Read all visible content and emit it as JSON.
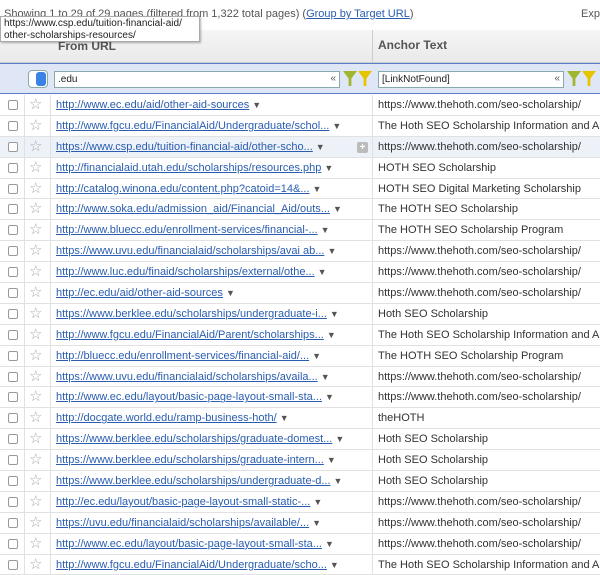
{
  "summary": {
    "text": "Showing 1 to 29 of 29 pages (filtered from 1,322 total pages) (",
    "group_link": "Group by Target URL",
    "close": ")"
  },
  "export_label": "Exp",
  "tooltip": "https://www.csp.edu/tuition-financial-aid/ other-scholarships-resources/",
  "columns": {
    "from_url": "From URL",
    "anchor_text": "Anchor Text"
  },
  "filters": {
    "from_url": ".edu",
    "anchor_text": "[LinkNotFound]",
    "clear": "«"
  },
  "icons": {
    "star": "star-icon",
    "funnel": "filter-funnel-icon",
    "expand": "expand-plus-icon"
  },
  "rows": [
    {
      "url": "http://www.ec.edu/aid/other-aid-sources",
      "anchor": "https://www.thehoth.com/seo-scholarship/"
    },
    {
      "url": "http://www.fgcu.edu/FinancialAid/Undergraduate/schol...",
      "anchor": "The Hoth SEO Scholarship Information and Ap"
    },
    {
      "url": "https://www.csp.edu/tuition-financial-aid/other-scho...",
      "anchor": "https://www.thehoth.com/seo-scholarship/",
      "highlight": true
    },
    {
      "url": "http://financialaid.utah.edu/scholarships/resources.php",
      "anchor": "HOTH SEO Scholarship"
    },
    {
      "url": "http://catalog.winona.edu/content.php?catoid=14&...",
      "anchor": "HOTH SEO Digital Marketing Scholarship"
    },
    {
      "url": "http://www.soka.edu/admission_aid/Financial_Aid/outs...",
      "anchor": "The HOTH SEO Scholarship"
    },
    {
      "url": "http://www.bluecc.edu/enrollment-services/financial-...",
      "anchor": "The HOTH SEO Scholarship Program"
    },
    {
      "url": "https://www.uvu.edu/financialaid/scholarships/avai ab...",
      "anchor": "https://www.thehoth.com/seo-scholarship/"
    },
    {
      "url": "http://www.luc.edu/finaid/scholarships/external/othe...",
      "anchor": "https://www.thehoth.com/seo-scholarship/"
    },
    {
      "url": "http://ec.edu/aid/other-aid-sources",
      "anchor": "https://www.thehoth.com/seo-scholarship/"
    },
    {
      "url": "https://www.berklee.edu/scholarships/undergraduate-i...",
      "anchor": "Hoth SEO Scholarship"
    },
    {
      "url": "http://www.fgcu.edu/FinancialAid/Parent/scholarships...",
      "anchor": "The Hoth SEO Scholarship Information and Ap"
    },
    {
      "url": "http://bluecc.edu/enrollment-services/financial-aid/...",
      "anchor": "The HOTH SEO Scholarship Program"
    },
    {
      "url": "https://www.uvu.edu/financialaid/scholarships/availa...",
      "anchor": "https://www.thehoth.com/seo-scholarship/"
    },
    {
      "url": "http://www.ec.edu/layout/basic-page-layout-small-sta...",
      "anchor": "https://www.thehoth.com/seo-scholarship/"
    },
    {
      "url": "http://docgate.world.edu/ramp-business-hoth/",
      "anchor": "theHOTH"
    },
    {
      "url": "https://www.berklee.edu/scholarships/graduate-domest...",
      "anchor": "Hoth SEO Scholarship"
    },
    {
      "url": "https://www.berklee.edu/scholarships/graduate-intern...",
      "anchor": "Hoth SEO Scholarship"
    },
    {
      "url": "https://www.berklee.edu/scholarships/undergraduate-d...",
      "anchor": "Hoth SEO Scholarship"
    },
    {
      "url": "http://ec.edu/layout/basic-page-layout-small-static-...",
      "anchor": "https://www.thehoth.com/seo-scholarship/"
    },
    {
      "url": "https://uvu.edu/financialaid/scholarships/available/...",
      "anchor": "https://www.thehoth.com/seo-scholarship/"
    },
    {
      "url": "http://www.ec.edu/layout/basic-page-layout-small-sta...",
      "anchor": "https://www.thehoth.com/seo-scholarship/"
    },
    {
      "url": "http://www.fgcu.edu/FinancialAid/Undergraduate/scho...",
      "anchor": "The Hoth SEO Scholarship Information and Ap"
    }
  ]
}
